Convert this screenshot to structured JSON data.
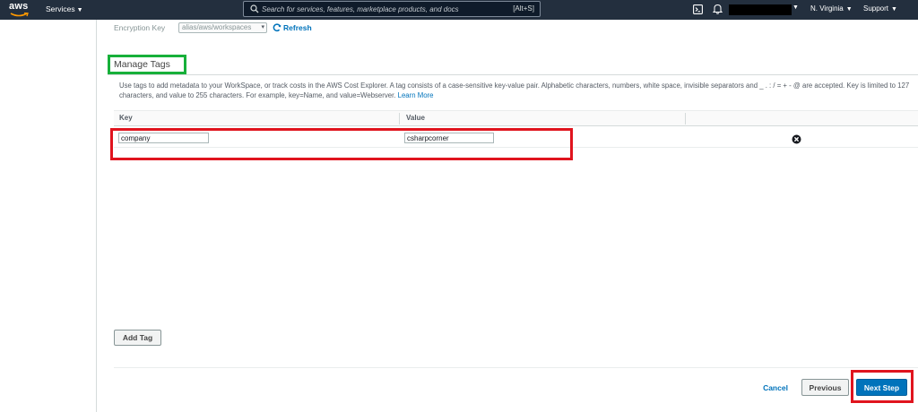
{
  "nav": {
    "logo": "aws",
    "services_label": "Services",
    "search_placeholder": "Search for services, features, marketplace products, and docs",
    "search_shortcut": "[Alt+S]",
    "region_label": "N. Virginia",
    "support_label": "Support"
  },
  "encryption": {
    "label": "Encryption Key",
    "selected_value": "alias/aws/workspaces",
    "refresh_label": "Refresh"
  },
  "tags": {
    "title": "Manage Tags",
    "description": "Use tags to add metadata to your WorkSpace, or track costs in the AWS Cost Explorer. A tag consists of a case-sensitive key-value pair. Alphabetic characters, numbers, white space, invisible separators and _ . : / = + - @ are accepted. Key is limited to 127 characters, and value to 255 characters. For example, key=Name, and value=Webserver.",
    "learn_more": "Learn More",
    "columns": [
      "Key",
      "Value"
    ],
    "rows": [
      {
        "key": "company",
        "value": "csharpcorner"
      }
    ],
    "add_tag_label": "Add Tag"
  },
  "footer": {
    "cancel_label": "Cancel",
    "previous_label": "Previous",
    "next_label": "Next Step"
  },
  "colors": {
    "nav_bg": "#232f3e",
    "link": "#0073bb",
    "primary_button": "#0073bb",
    "highlight_green": "#17b03a",
    "highlight_red": "#e0141e"
  }
}
